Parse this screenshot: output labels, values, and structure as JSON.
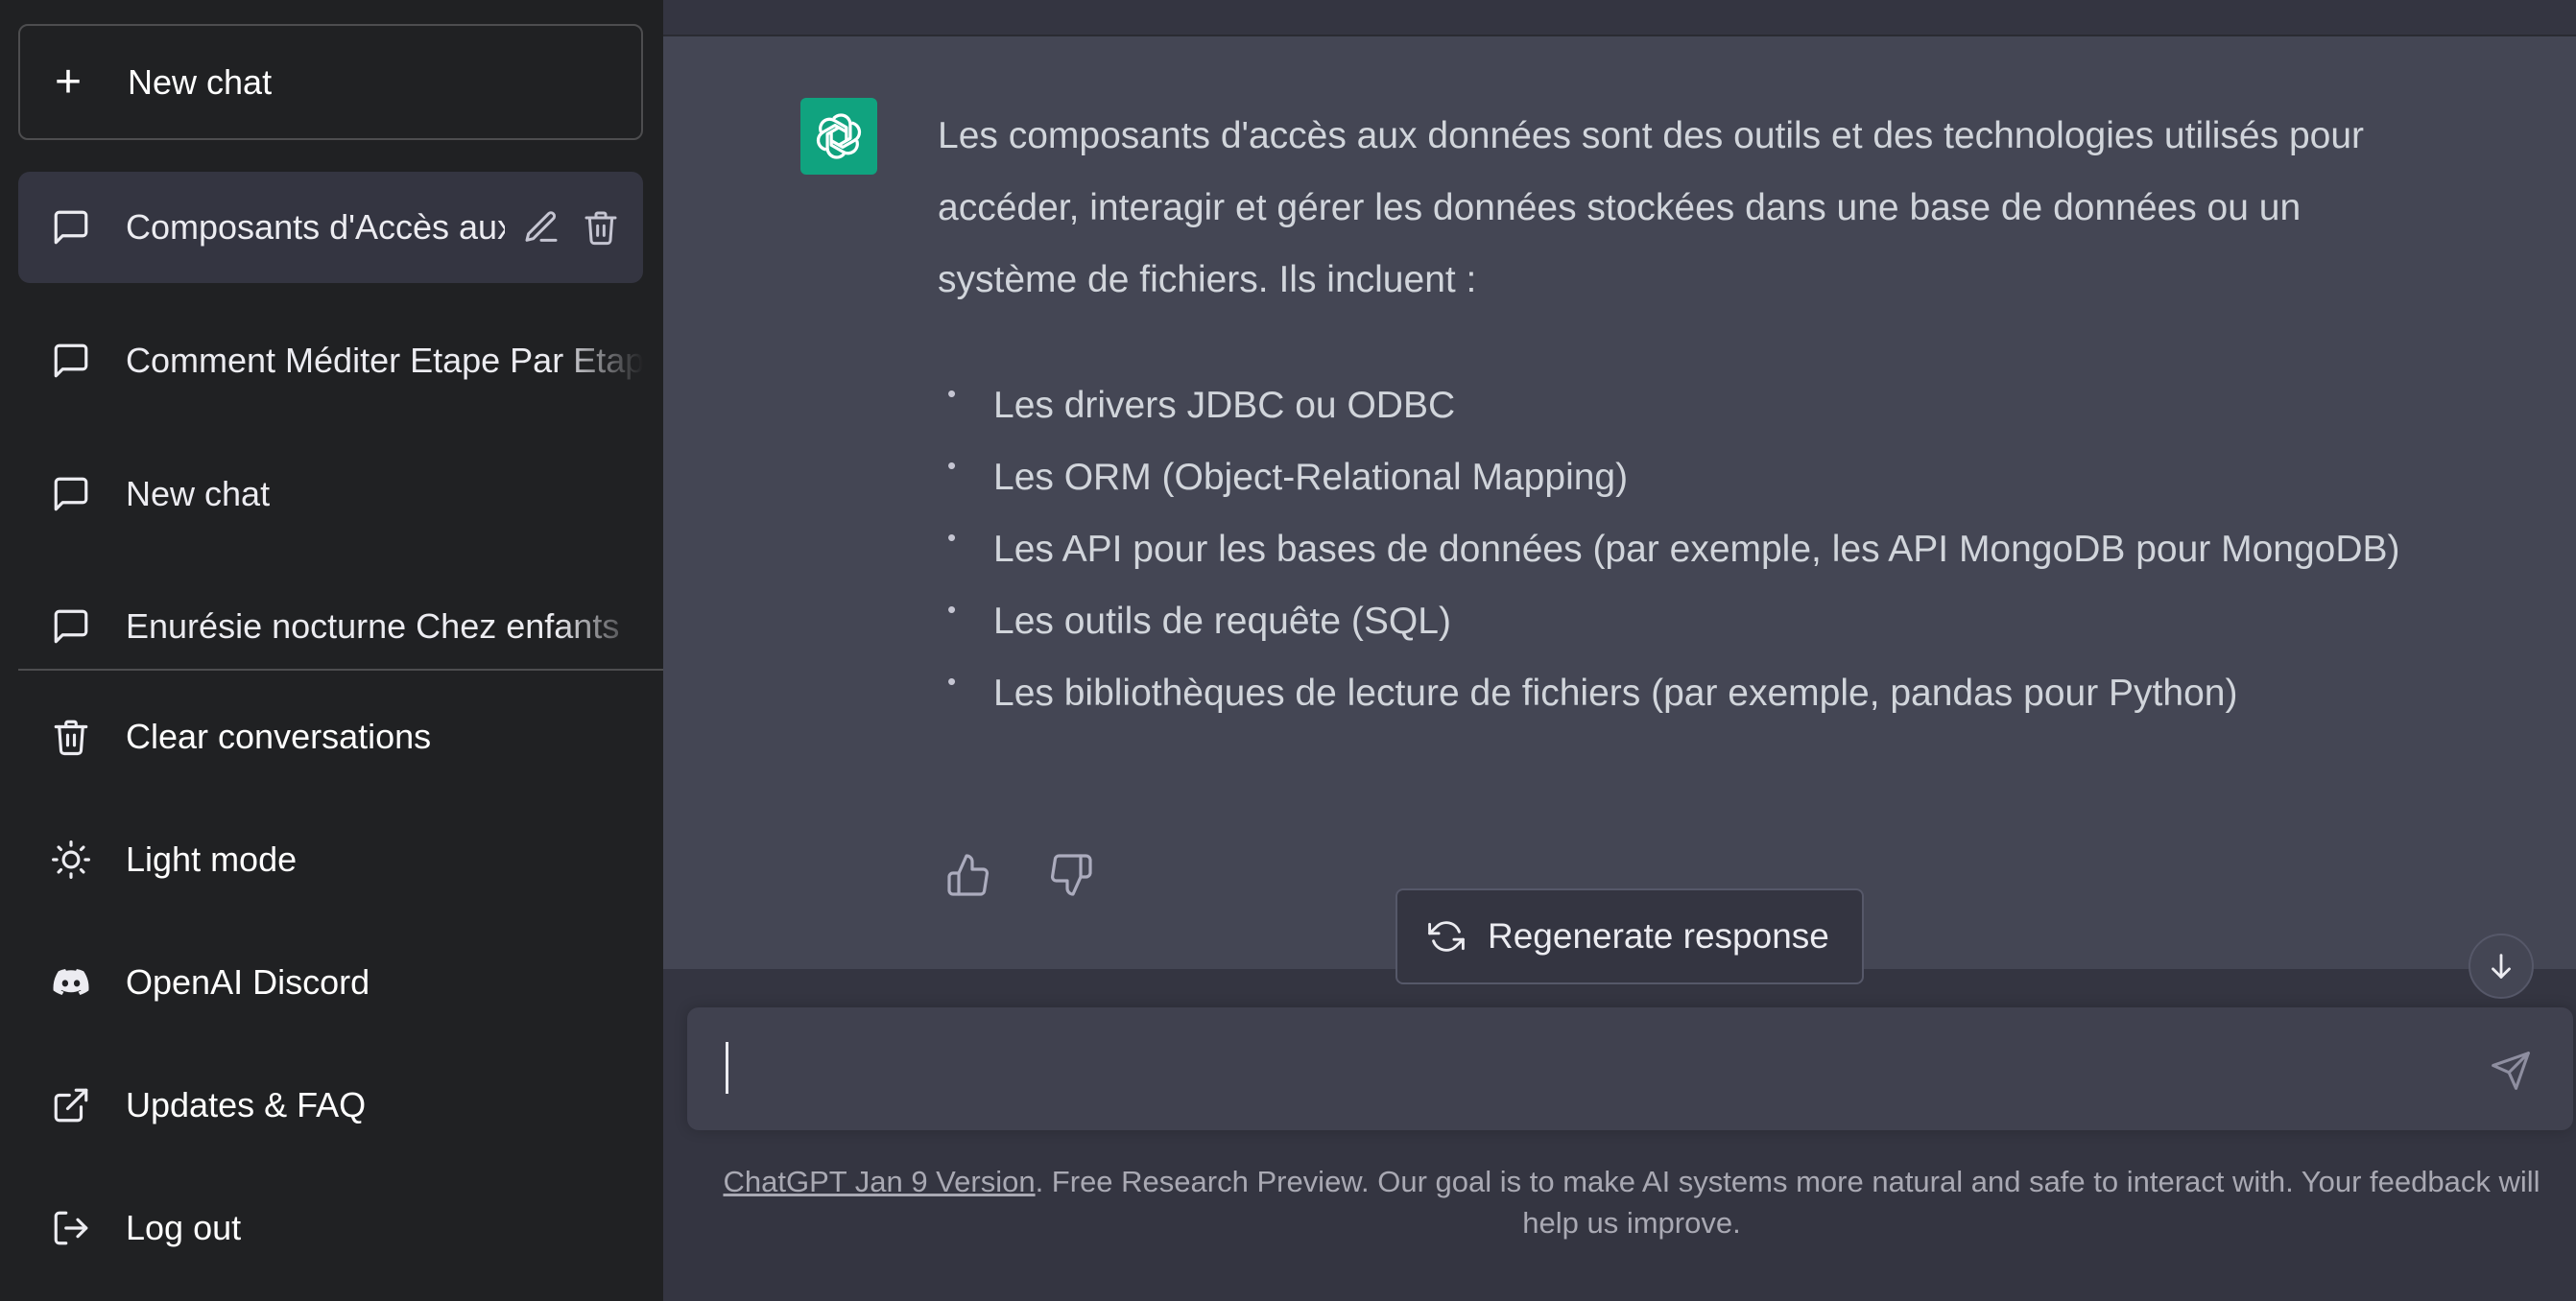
{
  "sidebar": {
    "new_chat": "New chat",
    "conversations": [
      {
        "title": "Composants d'Accès aux Données"
      },
      {
        "title": "Comment Méditer Etape Par Etape"
      },
      {
        "title": "New chat"
      },
      {
        "title": "Enurésie nocturne Chez enfants"
      }
    ],
    "menu": {
      "clear": "Clear conversations",
      "light_mode": "Light mode",
      "discord": "OpenAI Discord",
      "updates": "Updates & FAQ",
      "logout": "Log out"
    }
  },
  "message": {
    "intro": "Les composants d'accès aux données sont des outils et des technologies utilisés pour accéder, interagir et gérer les données stockées dans une base de données ou un système de fichiers. Ils incluent :",
    "items": [
      "Les drivers JDBC ou ODBC",
      "Les ORM (Object-Relational Mapping)",
      "Les API pour les bases de données (par exemple, les API MongoDB pour MongoDB)",
      "Les outils de requête (SQL)",
      "Les bibliothèques de lecture de fichiers (par exemple, pandas pour Python)"
    ]
  },
  "regenerate_label": "Regenerate response",
  "input": {
    "value": ""
  },
  "footer": {
    "link": "ChatGPT Jan 9 Version",
    "text": ". Free Research Preview. Our goal is to make AI systems more natural and safe to interact with. Your feedback will help us improve."
  },
  "colors": {
    "sidebar_bg": "#202123",
    "main_bg": "#343541",
    "message_bg": "#444654",
    "accent": "#10a37f"
  },
  "icons": [
    "plus-icon",
    "chat-bubble-icon",
    "edit-icon",
    "trash-icon",
    "sun-icon",
    "discord-icon",
    "external-link-icon",
    "logout-icon",
    "openai-logo-icon",
    "thumbs-up-icon",
    "thumbs-down-icon",
    "refresh-icon",
    "arrow-down-icon",
    "send-icon"
  ]
}
